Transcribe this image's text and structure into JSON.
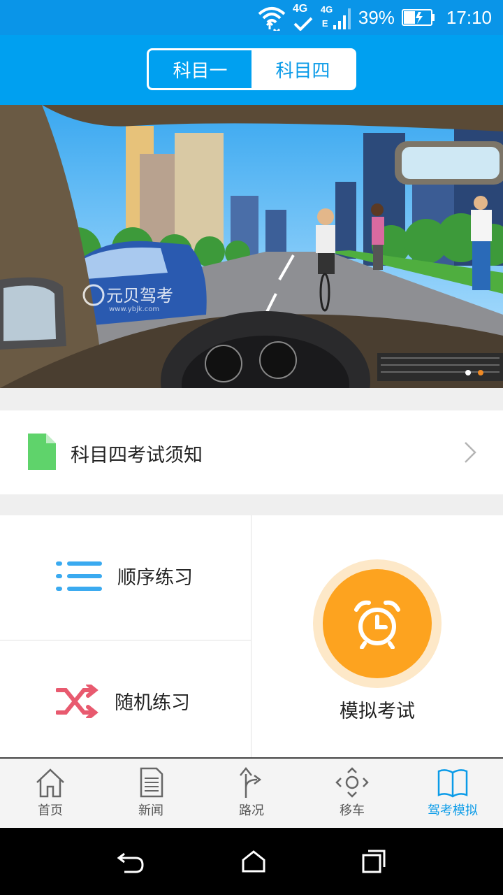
{
  "status_bar": {
    "battery": "39%",
    "time": "17:10",
    "network_1": "4G",
    "network_2": "4G",
    "network_2_sub": "E",
    "icons": [
      "wifi-icon",
      "signal-4g-icon",
      "battery-icon"
    ]
  },
  "header": {
    "tabs": [
      {
        "label": "科目一",
        "active": true
      },
      {
        "label": "科目四",
        "active": false
      }
    ]
  },
  "banner": {
    "watermark": "元贝驾考",
    "watermark_url": "www.ybjk.com",
    "dots": 2,
    "active_dot": 1
  },
  "notice": {
    "label": "科目四考试须知",
    "icon": "document-icon"
  },
  "practice": {
    "sequential": "顺序练习",
    "random": "随机练习",
    "mock_exam": "模拟考试"
  },
  "tabbar": {
    "items": [
      {
        "label": "首页",
        "icon": "home-icon"
      },
      {
        "label": "新闻",
        "icon": "news-icon"
      },
      {
        "label": "路况",
        "icon": "road-icon"
      },
      {
        "label": "移车",
        "icon": "move-car-icon"
      },
      {
        "label": "驾考模拟",
        "icon": "book-icon",
        "active": true
      }
    ]
  },
  "colors": {
    "primary": "#00a0f0",
    "accent_orange": "#fda31f",
    "doc_green": "#5fd36b",
    "shuffle_red": "#e85a6f",
    "list_blue": "#3aaaf0"
  }
}
